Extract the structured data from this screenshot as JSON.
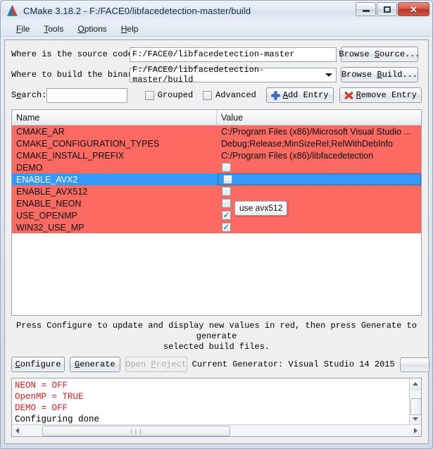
{
  "window": {
    "title": "CMake 3.18.2 - F:/FACE0/libfacedetection-master/build",
    "logo_icon": "cmake-logo-icon",
    "minimize_icon": "minimize-icon",
    "maximize_icon": "restore-icon",
    "close_icon": "close-icon"
  },
  "menubar": {
    "items": [
      {
        "label": "File",
        "accel": "F"
      },
      {
        "label": "Tools",
        "accel": "T"
      },
      {
        "label": "Options",
        "accel": "O"
      },
      {
        "label": "Help",
        "accel": "H"
      }
    ]
  },
  "form": {
    "source_label": "Where is the source code:",
    "source_value": "F:/FACE0/libfacedetection-master",
    "browse_source_label": "Browse Source...",
    "browse_source_accel": "S",
    "build_label": "Where to build the binaries:",
    "build_value": "F:/FACE0/libfacedetection-master/build",
    "browse_build_label": "Browse Build...",
    "browse_build_accel": "B",
    "search_label": "Search:",
    "search_accel": "e",
    "search_value": "",
    "search_placeholder": "",
    "grouped_label": "Grouped",
    "grouped_checked": false,
    "advanced_label": "Advanced",
    "advanced_checked": false,
    "add_entry_label": "Add Entry",
    "add_entry_accel": "A",
    "add_entry_icon": "plus-icon",
    "remove_entry_label": "Remove Entry",
    "remove_entry_accel": "R",
    "remove_entry_icon": "x-icon"
  },
  "table": {
    "columns": [
      "Name",
      "Value"
    ],
    "rows": [
      {
        "name": "CMAKE_AR",
        "value": "C:/Program Files (x86)/Microsoft Visual Studio ...",
        "type": "text",
        "modified": true,
        "selected": false
      },
      {
        "name": "CMAKE_CONFIGURATION_TYPES",
        "value": "Debug;Release;MinSizeRel;RelWithDebInfo",
        "type": "text",
        "modified": true,
        "selected": false
      },
      {
        "name": "CMAKE_INSTALL_PREFIX",
        "value": "C:/Program Files (x86)/libfacedetection",
        "type": "text",
        "modified": true,
        "selected": false
      },
      {
        "name": "DEMO",
        "value": "",
        "type": "checkbox",
        "checked": false,
        "modified": true,
        "selected": false
      },
      {
        "name": "ENABLE_AVX2",
        "value": "",
        "type": "checkbox",
        "checked": false,
        "modified": true,
        "selected": true
      },
      {
        "name": "ENABLE_AVX512",
        "value": "",
        "type": "checkbox",
        "checked": false,
        "modified": true,
        "selected": false
      },
      {
        "name": "ENABLE_NEON",
        "value": "",
        "type": "checkbox",
        "checked": false,
        "modified": true,
        "selected": false
      },
      {
        "name": "USE_OPENMP",
        "value": "",
        "type": "checkbox",
        "checked": true,
        "modified": true,
        "selected": false
      },
      {
        "name": "WIN32_USE_MP",
        "value": "",
        "type": "checkbox",
        "checked": true,
        "modified": true,
        "selected": false
      }
    ],
    "tooltip": "use avx512"
  },
  "hint": {
    "line1": "Press Configure to update and display new values in red, then press Generate to generate",
    "line2": "selected build files."
  },
  "actions": {
    "configure_label": "Configure",
    "configure_accel": "C",
    "generate_label": "Generate",
    "generate_accel": "G",
    "open_project_label": "Open Project",
    "open_project_enabled": false,
    "generator_label": "Current Generator: Visual Studio 14 2015",
    "progress_percent": 0
  },
  "log": {
    "lines": [
      {
        "text": "NEON = OFF",
        "color": "red"
      },
      {
        "text": "OpenMP = TRUE",
        "color": "red"
      },
      {
        "text": "DEMO = OFF",
        "color": "red"
      },
      {
        "text": "Configuring done",
        "color": "black"
      }
    ],
    "vscroll_up_icon": "scroll-up-icon",
    "vscroll_down_icon": "scroll-down-icon",
    "hscroll_left_icon": "scroll-left-icon",
    "hscroll_right_icon": "scroll-right-icon"
  },
  "colors": {
    "modified_row": "#fc6a62",
    "selected_row": "#3399fb",
    "log_red": "#e02020",
    "close_button": "#b93326"
  }
}
